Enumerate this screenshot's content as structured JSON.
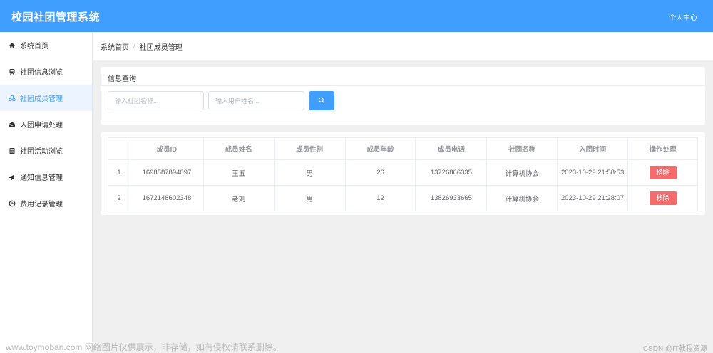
{
  "header": {
    "title": "校园社团管理系统",
    "user_center": "个人中心"
  },
  "sidebar": {
    "items": [
      {
        "label": "系统首页",
        "icon": "home-icon",
        "active": false
      },
      {
        "label": "社团信息浏览",
        "icon": "train-icon",
        "active": false
      },
      {
        "label": "社团成员管理",
        "icon": "group-icon",
        "active": true
      },
      {
        "label": "入团申请处理",
        "icon": "envelope-icon",
        "active": false
      },
      {
        "label": "社团活动浏览",
        "icon": "calculator-icon",
        "active": false
      },
      {
        "label": "通知信息管理",
        "icon": "megaphone-icon",
        "active": false
      },
      {
        "label": "费用记录管理",
        "icon": "clock-icon",
        "active": false
      }
    ]
  },
  "breadcrumb": {
    "home": "系统首页",
    "separator": "/",
    "current": "社团成员管理"
  },
  "search": {
    "title": "信息查询",
    "club_placeholder": "输入社团名称...",
    "user_placeholder": "输入用户姓名...",
    "button_icon": "search-icon"
  },
  "table": {
    "columns": [
      "",
      "成员ID",
      "成员姓名",
      "成员性别",
      "成员年龄",
      "成员电话",
      "社团名称",
      "入团时间",
      "操作处理"
    ],
    "rows": [
      {
        "index": "1",
        "id": "1698587894097",
        "name": "王五",
        "gender": "男",
        "age": "26",
        "phone": "13726866335",
        "club": "计算机协会",
        "joined": "2023-10-29 21:58:53",
        "action": "移除"
      },
      {
        "index": "2",
        "id": "1672148602348",
        "name": "老刘",
        "gender": "男",
        "age": "12",
        "phone": "13826933665",
        "club": "计算机协会",
        "joined": "2023-10-29 21:28:07",
        "action": "移除"
      }
    ]
  },
  "watermark": {
    "left": "www.toymoban.com 网络图片仅供展示，非存储，如有侵权请联系删除。",
    "right": "CSDN @IT教程资源"
  },
  "colors": {
    "primary": "#409eff",
    "danger": "#f56c6c",
    "active_bg": "#ecf5ff"
  }
}
